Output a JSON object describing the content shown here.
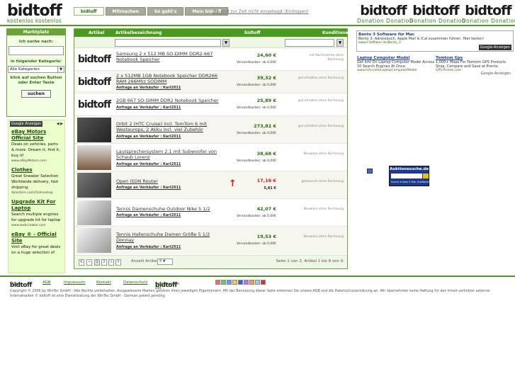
{
  "brand": {
    "logo_text": "bidtoff",
    "tagline": "kostenlos kostenlos"
  },
  "nav": {
    "tabs": [
      "bidtoff",
      "Mitmachen",
      "So geht's",
      "Mein bidtoff"
    ],
    "login_status": "Sie sind zur Zeit nicht eingeloggt (Einloggen)"
  },
  "donation": {
    "label": "Donation",
    "logo_text": "bidtoff"
  },
  "sidebar": {
    "title": "Marktplatz",
    "search_label": "Ich suche nach:",
    "category_label": "in folgender Kategorie:",
    "category_value": "Alle Kategorien",
    "hint": "klick auf suchen Button oder Enter Taste",
    "search_button": "suchen"
  },
  "ads_left": {
    "badge": "Google Anzeigen",
    "items": [
      {
        "title": "eBay Motors Official Site",
        "body": "Deals on vehicles, parts & more. Dream it, find it, buy it!",
        "url": "www.eBayMotors.com"
      },
      {
        "title": "Clothes",
        "body": "Great Sneaker Selection Worldwide delivery, fast shipping.",
        "url": "Aylastore.com/Onlineshop"
      },
      {
        "title": "Upgrade Kit For Laptop",
        "body": "Search multiple engines for upgrade kit for laptop",
        "url": "www.webcrawler.com"
      },
      {
        "title": "eBay ® - Official Site",
        "body": "Visit eBay for great deals on a huge selection of",
        "url": ""
      }
    ]
  },
  "table": {
    "headers": {
      "article": "Artikel",
      "description": "Artikelbezeichnung",
      "logo": "bidtoff",
      "conditions": "Konditionen"
    },
    "shipping_prefix": "Versandkosten: ab",
    "rows": [
      {
        "title": "Samsung 2 x 512 MB SO-DIMM DDR2-667 Notebook Speicher",
        "seller": "",
        "price": "24,60 €",
        "shipping": "Versandkosten: ab 0,00€",
        "note": "mit Nachnahme ohne Rechnung"
      },
      {
        "title": "2 x 512MB 1GB Notebook Speicher DDR266 RAM 266Mhz SODIMM",
        "seller": "Anfrage an Verkäufer : Karl2011",
        "price": "39,32 €",
        "shipping": "Versandkosten: ab 0,00€",
        "note": "gut erhalten ohne Rechnung"
      },
      {
        "title": "2GB 667 SO-DIMM DDR2 Notebook Speicher",
        "seller": "Anfrage an Verkäufer : Karl2011",
        "price": "25,89 €",
        "shipping": "Versandkosten: ab 0,00€",
        "note": "gut erhalten ohne Rechnung"
      },
      {
        "title": "Orbit 2 (HTC Cruise) incl. TomTom 6 mit Westeurops, 2 Akku incl. viel Zubehör",
        "seller": "Anfrage an Verkäufer : Karl2011",
        "price": "273,82 €",
        "shipping": "Versandkosten: ab 0,00€",
        "note": "gut erhalten ohne Rechnung"
      },
      {
        "title": "Lautsprechersystem 2.1 mit Subwoofer von Schaub Lorenz",
        "seller": "Anfrage an Verkäufer : Karl2011",
        "price": "38,68 €",
        "shipping": "Versandkosten: ab 0,00€",
        "note": "Neuware ohne Rechnung"
      },
      {
        "title": "Open ISDN Router",
        "seller": "Anfrage an Verkäufer : Karl2011",
        "price": "17,16 €",
        "old_price": "5,61 €",
        "shipping": "",
        "note": "gebraucht ohne Rechnung"
      },
      {
        "title": "Tennis Damenschuhe Outdoor Nike 5 1/2",
        "seller": "Anfrage an Verkäufer : Karl2011",
        "price": "42,07 €",
        "shipping": "Versandkosten: ab 0,00€",
        "note": "Neuware ohne Rechnung"
      },
      {
        "title": "Tennis Hallenschuhe Damen Größe 5 1/2 Donnay",
        "seller": "Anfrage an Verkäufer : Karl2011",
        "price": "19,53 €",
        "shipping": "Versandkosten: ab 0,00€",
        "note": "Neuware ohne Rechnung"
      }
    ],
    "pager": {
      "pages": [
        "K",
        "<",
        "1",
        "2",
        ">",
        "X"
      ],
      "per_page_label": "Anzahl Artikel:",
      "per_page_value": "8",
      "info": "Seite 1 von 2, Artikel 1 bis 8 von 9."
    }
  },
  "right": {
    "ad1": {
      "title": "Bento 3 Software für Mac",
      "body": "Bento 3: Adressbuch, Apple Mail & iCal zusammen führen. Hier testen!",
      "url": "www.FileMaker.de/Bento_3"
    },
    "ad2a": {
      "title": "Laptop Computer Model",
      "body": "Get Info On Laptop Computer Model Access 10 Search Engines At Once.",
      "url": "www.Info.com/LaptopComputerModel"
    },
    "ad2b": {
      "title": "Tomtom Gps",
      "body": "1,000+ Maps For Tomtom GPS Products Shop, Compare and Save at Pronto.",
      "url": "GPS.Pronto.com"
    },
    "google_badge": "Google-Anzeigen",
    "auktion": {
      "title": "Auktionssuche.de",
      "sub": "Suche in über 5 Mio. Auktionen"
    }
  },
  "footer": {
    "links": [
      "AGB",
      "Impressum",
      "Kontakt",
      "Datenschutz"
    ],
    "prefix": "Über",
    "bookmark": "bookmarken bei:",
    "copyright": "Copyright © 2006 by WinTec GmbH - Alle Rechte vorbehalten. Ausgewiesene Marken gehören ihren jeweiligen Eigentümern. Mit der Benutzung dieser Seite erkennen Sie unsere AGB und die Datenschutzerklärung an. Wir übernehmen keine Haftung für den Inhalt verlinkter externer Internetseiten © bidtoff ist eine Dienstleistung der WinTec GmbH - German patent pending"
  }
}
